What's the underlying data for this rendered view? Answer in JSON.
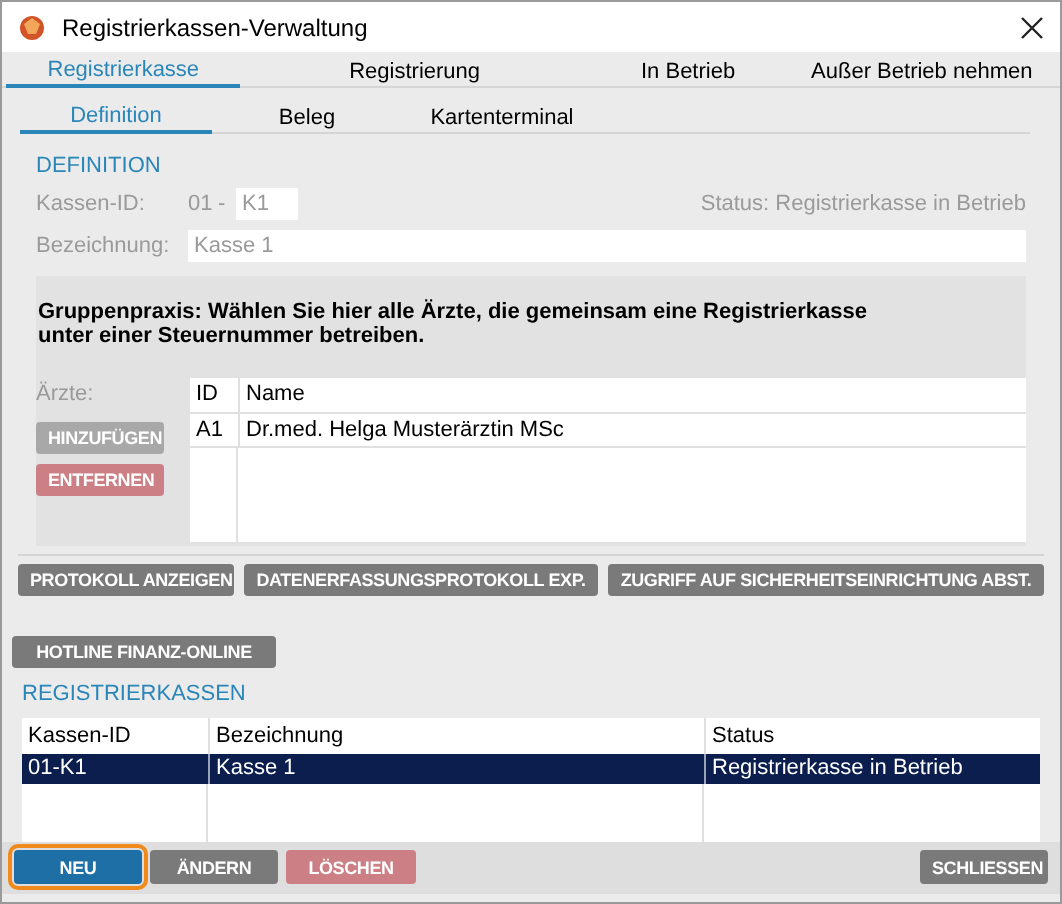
{
  "window": {
    "title": "Registrierkassen-Verwaltung"
  },
  "tabs": [
    {
      "label": "Registrierkasse",
      "selected": true
    },
    {
      "label": "Registrierung",
      "selected": false
    },
    {
      "label": "In Betrieb",
      "selected": false
    },
    {
      "label": "Außer Betrieb nehmen",
      "selected": false
    }
  ],
  "subtabs": [
    {
      "label": "Definition",
      "selected": true
    },
    {
      "label": "Beleg",
      "selected": false
    },
    {
      "label": "Kartenterminal",
      "selected": false
    }
  ],
  "definition": {
    "heading": "DEFINITION",
    "kassen_id_label": "Kassen-ID:",
    "kassen_id_prefix": "01",
    "separator": "-",
    "kassen_id_value": "K1",
    "status": "Status: Registrierkasse in Betrieb",
    "bezeichnung_label": "Bezeichnung:",
    "bezeichnung_value": "Kasse 1"
  },
  "gruppenpraxis": {
    "text": "Gruppenpraxis: Wählen Sie hier alle Ärzte, die gemeinsam eine Registrierkasse\nunter einer Steuernummer betreiben.",
    "aerzte_label": "Ärzte:",
    "buttons": [
      {
        "label": "HINZUFÜGEN",
        "kind": "normal",
        "disabled": true
      },
      {
        "label": "ENTFERNEN",
        "kind": "danger",
        "disabled": true
      }
    ],
    "table": {
      "columns": [
        "ID",
        "Name"
      ],
      "rows": [
        [
          "A1",
          "Dr.med. Helga Musterärztin MSc"
        ]
      ]
    }
  },
  "actions": [
    {
      "label": "PROTOKOLL ANZEIGEN",
      "kind": "normal",
      "disabled": false
    },
    {
      "label": "DATENERFASSUNGSPROTOKOLL EXP.",
      "kind": "normal",
      "disabled": false
    },
    {
      "label": "ZUGRIFF AUF SICHERHEITSEINRICHTUNG ABST.",
      "kind": "normal",
      "disabled": false
    }
  ],
  "hotline": {
    "label": "HOTLINE FINANZ-ONLINE",
    "kind": "normal",
    "disabled": false
  },
  "registrierkassen": {
    "heading": "REGISTRIERKASSEN",
    "columns": [
      "Kassen-ID",
      "Bezeichnung",
      "Status"
    ],
    "rows": [
      {
        "cells": [
          "01-K1",
          "Kasse 1",
          "Registrierkasse in Betrieb"
        ],
        "selected": true
      }
    ]
  },
  "footer_buttons": [
    {
      "label": "NEU",
      "kind": "primary",
      "disabled": false,
      "focused": true
    },
    {
      "label": "ÄNDERN",
      "kind": "normal",
      "disabled": false,
      "focused": false
    },
    {
      "label": "LÖSCHEN",
      "kind": "danger",
      "disabled": true,
      "focused": false
    },
    {
      "label": "SCHLIESSEN",
      "kind": "normal",
      "disabled": false,
      "focused": false
    }
  ]
}
